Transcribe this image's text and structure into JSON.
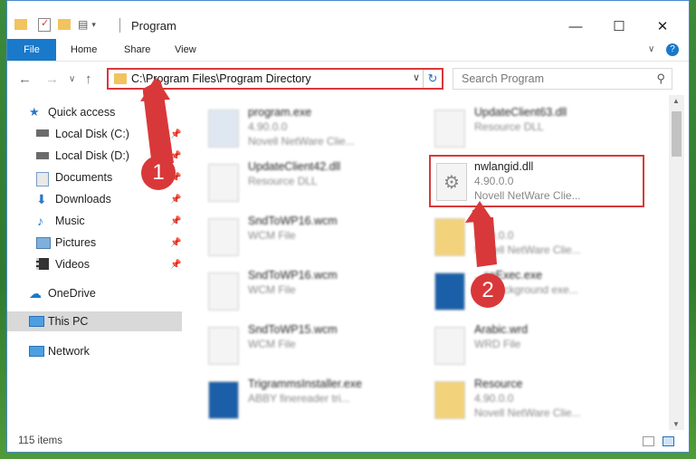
{
  "window": {
    "title": "Program"
  },
  "ribbon": {
    "tabs": [
      "File",
      "Home",
      "Share",
      "View"
    ],
    "help": "?"
  },
  "address": {
    "path": "C:\\Program Files\\Program Directory"
  },
  "search": {
    "placeholder": "Search Program"
  },
  "sidebar": {
    "items": [
      {
        "label": "Quick access",
        "icon": "star-icon"
      },
      {
        "label": "Local Disk (C:)",
        "icon": "drive-icon",
        "pinned": true
      },
      {
        "label": "Local Disk (D:)",
        "icon": "drive-icon",
        "pinned": true
      },
      {
        "label": "Documents",
        "icon": "documents-icon",
        "pinned": true
      },
      {
        "label": "Downloads",
        "icon": "download-icon",
        "pinned": true
      },
      {
        "label": "Music",
        "icon": "music-icon",
        "pinned": true
      },
      {
        "label": "Pictures",
        "icon": "pictures-icon",
        "pinned": true
      },
      {
        "label": "Videos",
        "icon": "videos-icon",
        "pinned": true
      },
      {
        "label": "OneDrive",
        "icon": "cloud-icon"
      },
      {
        "label": "This PC",
        "icon": "pc-icon",
        "selected": true
      },
      {
        "label": "Network",
        "icon": "network-icon"
      }
    ]
  },
  "files": [
    {
      "name": "program.exe",
      "line2": "4.90.0.0",
      "line3": "Novell NetWare Clie..."
    },
    {
      "name": "UpdateClient63.dll",
      "line2": "Resource DLL",
      "line3": ""
    },
    {
      "name": "UpdateClient42.dll",
      "line2": "Resource DLL",
      "line3": ""
    },
    {
      "name": "nwlangid.dll",
      "line2": "4.90.0.0",
      "line3": "Novell NetWare Clie..."
    },
    {
      "name": "SndToWP16.wcm",
      "line2": "WCM File",
      "line3": ""
    },
    {
      "name": "",
      "line2": "4.90.0.0",
      "line3": "Novell NetWare Clie..."
    },
    {
      "name": "SndToWP16.wcm",
      "line2": "WCM File",
      "line3": ""
    },
    {
      "name": "...ceExec.exe",
      "line2": "...y background exe...",
      "line3": ""
    },
    {
      "name": "SndToWP15.wcm",
      "line2": "WCM File",
      "line3": ""
    },
    {
      "name": "Arabic.wrd",
      "line2": "WRD File",
      "line3": ""
    },
    {
      "name": "TrigrammsInstaller.exe",
      "line2": "ABBY finereader tri...",
      "line3": ""
    },
    {
      "name": "Resource",
      "line2": "4.90.0.0",
      "line3": "Novell NetWare Clie..."
    }
  ],
  "status": {
    "count": "115 items"
  },
  "badges": [
    "1",
    "2"
  ],
  "colors": {
    "accent": "#1979ca",
    "highlight": "#d9383a"
  }
}
